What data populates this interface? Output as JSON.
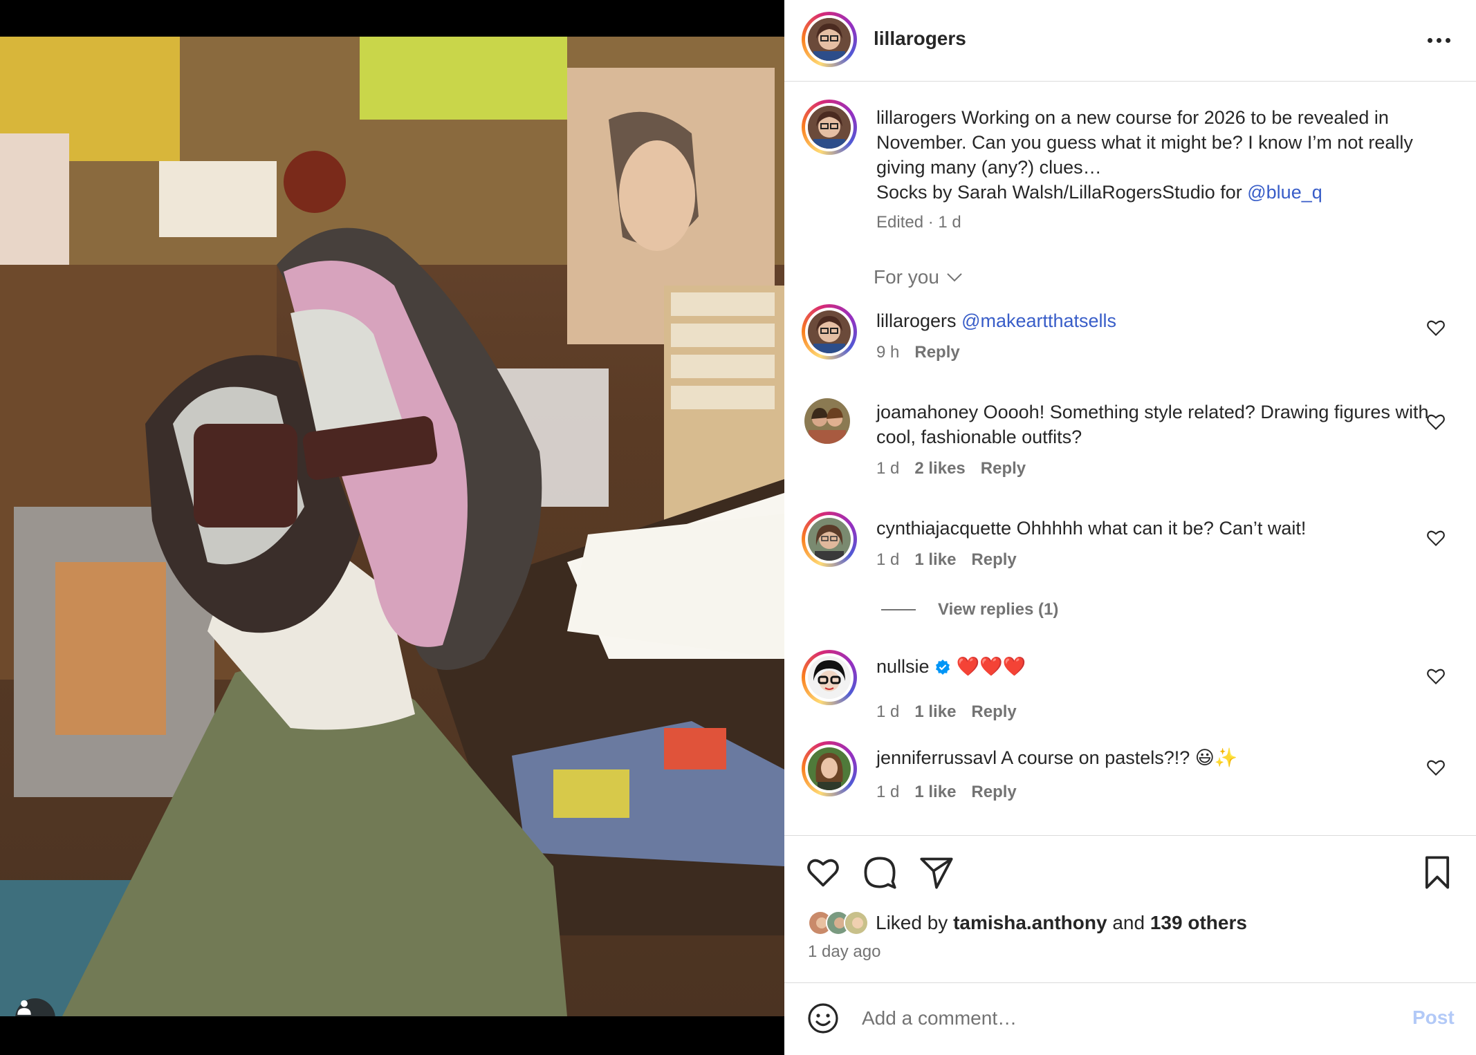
{
  "post": {
    "username": "lillarogers",
    "more_icon": "more-horizontal-icon"
  },
  "caption": {
    "username": "lillarogers",
    "line1": "Working on a new course for 2026 to be revealed in November. Can you guess what it might be? I know I’m not really giving many (any?) clues…",
    "line2_prefix": "Socks by Sarah Walsh/LillaRogersStudio for ",
    "line2_mention": "@blue_q",
    "meta": "Edited · 1 d"
  },
  "sort": {
    "label": "For you",
    "icon": "chevron-down-icon"
  },
  "comments": [
    {
      "username": "lillarogers",
      "text": "",
      "mention": "@makeartthatsells",
      "time": "9 h",
      "likes": "",
      "reply": "Reply"
    },
    {
      "username": "joamahoney",
      "text": "Ooooh! Something style related? Drawing figures with cool, fashionable outfits?",
      "mention": "",
      "time": "1 d",
      "likes": "2 likes",
      "reply": "Reply"
    },
    {
      "username": "cynthiajacquette",
      "text": "Ohhhhh what can it be? Can’t wait!",
      "mention": "",
      "time": "1 d",
      "likes": "1 like",
      "reply": "Reply"
    },
    {
      "username": "nullsie",
      "text": "❤️❤️❤️",
      "mention": "",
      "time": "1 d",
      "likes": "1 like",
      "reply": "Reply",
      "verified": true
    },
    {
      "username": "jenniferrussavl",
      "text": "A course on pastels?!? 😃✨",
      "mention": "",
      "time": "1 d",
      "likes": "1 like",
      "reply": "Reply"
    }
  ],
  "view_replies": "View replies (1)",
  "actions": {
    "like_icon": "heart-icon",
    "comment_icon": "comment-icon",
    "share_icon": "send-icon",
    "save_icon": "bookmark-icon"
  },
  "likes": {
    "prefix": "Liked by ",
    "user": "tamisha.anthony",
    "middle": " and ",
    "others": "139 others"
  },
  "posted": "1 day ago",
  "comment_box": {
    "placeholder": "Add a comment…",
    "post_label": "Post",
    "emoji_icon": "smiley-icon"
  },
  "colors": {
    "link": "#385dc8",
    "muted": "#737373",
    "post_disabled": "#b2c9f7",
    "verified": "#0095f6"
  }
}
